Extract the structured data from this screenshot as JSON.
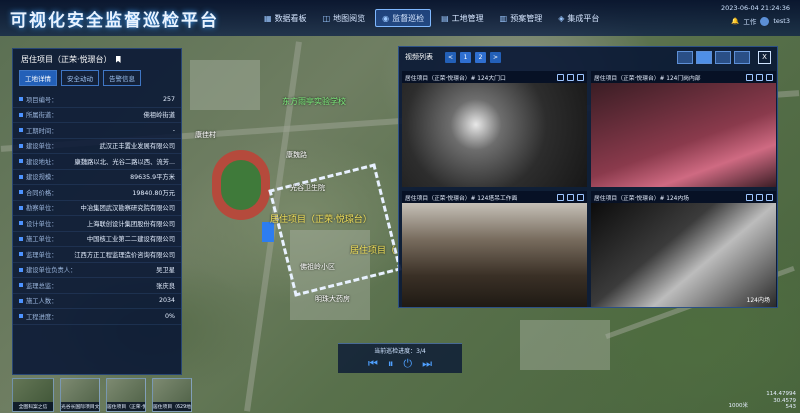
{
  "header": {
    "title": "可视化安全监督巡检平台",
    "nav": [
      {
        "label": "数据看板",
        "icon": "grid-icon"
      },
      {
        "label": "地图阅览",
        "icon": "map-icon"
      },
      {
        "label": "监督巡检",
        "icon": "camera-icon",
        "active": true
      },
      {
        "label": "工地管理",
        "icon": "building-icon"
      },
      {
        "label": "预案管理",
        "icon": "document-icon"
      },
      {
        "label": "集成平台",
        "icon": "cube-icon"
      }
    ],
    "datetime": "2023-06-04 21:24:36",
    "work_label": "工作",
    "username": "test3"
  },
  "project_panel": {
    "title": "居住项目（正荣·悦璟台）",
    "tabs": [
      "工地详情",
      "安全动动",
      "告警信息"
    ],
    "rows": [
      {
        "k": "项目编号：",
        "v": "257"
      },
      {
        "k": "所属街道：",
        "v": "佛祖岭街道"
      },
      {
        "k": "工期时间：",
        "v": "-"
      },
      {
        "k": "建设单位：",
        "v": "武汉正丰置业发展有限公司"
      },
      {
        "k": "建设地址：",
        "v": "康魏路以北、光谷二路以西、流芳..."
      },
      {
        "k": "建设规模：",
        "v": "89635.9平方米"
      },
      {
        "k": "合同价格：",
        "v": "19840.80万元"
      },
      {
        "k": "勘察单位：",
        "v": "中冶集团武汉勘察研究院有限公司"
      },
      {
        "k": "设计单位：",
        "v": "上海联创设计集团股份有限公司"
      },
      {
        "k": "施工单位：",
        "v": "中国核工业第二二建设有限公司"
      },
      {
        "k": "监理单位：",
        "v": "江西方正工程监理造价咨询有限公司"
      },
      {
        "k": "建设单位负责人：",
        "v": "吴卫星"
      },
      {
        "k": "监理总监：",
        "v": "张庆良"
      },
      {
        "k": "施工人数：",
        "v": "2034"
      },
      {
        "k": "工程进度：",
        "v": "0%"
      }
    ]
  },
  "video_panel": {
    "title": "视频列表",
    "prev": "<",
    "pages": [
      "1",
      "2"
    ],
    "next": ">",
    "close": "X",
    "cameras": [
      {
        "name": "居住项目（正荣·悦璟台）# 124大门口",
        "caption": ""
      },
      {
        "name": "居住项目（正荣·悦璟台）# 124门岗内部",
        "caption": ""
      },
      {
        "name": "居住项目（正荣·悦璟台）# 124塔吊工作面",
        "caption": ""
      },
      {
        "name": "居住项目（正荣·悦璟台）# 124内场",
        "caption": "124内场"
      }
    ]
  },
  "playback": {
    "label": "当前巡检进度：3/4",
    "controls": [
      "previous-icon",
      "pause-icon",
      "power-icon",
      "next-icon"
    ]
  },
  "map_labels": {
    "site_name": "居住项目（正荣·悦璟台）",
    "nearby_school": "东方雨亭实验学校",
    "place1": "康佳村",
    "place2": "光谷卫生院",
    "place3": "明珠大药房",
    "place4": "佛祖岭小区",
    "place5": "康魏路",
    "place6": "居住项目（"
  },
  "thumbnails": [
    {
      "label": "全图科案之信"
    },
    {
      "label": "光谷长国际项目文化广场1"
    },
    {
      "label": "居住项目（正荣·悦璟台）"
    },
    {
      "label": "居住项目（629地块"
    }
  ],
  "status": {
    "scale": "1000米",
    "lng": "114.47994",
    "lat": "30.4579",
    "alt": "543"
  },
  "colors": {
    "accent": "#2360b8",
    "panel": "#08163a",
    "highlight": "#4d93ff"
  }
}
